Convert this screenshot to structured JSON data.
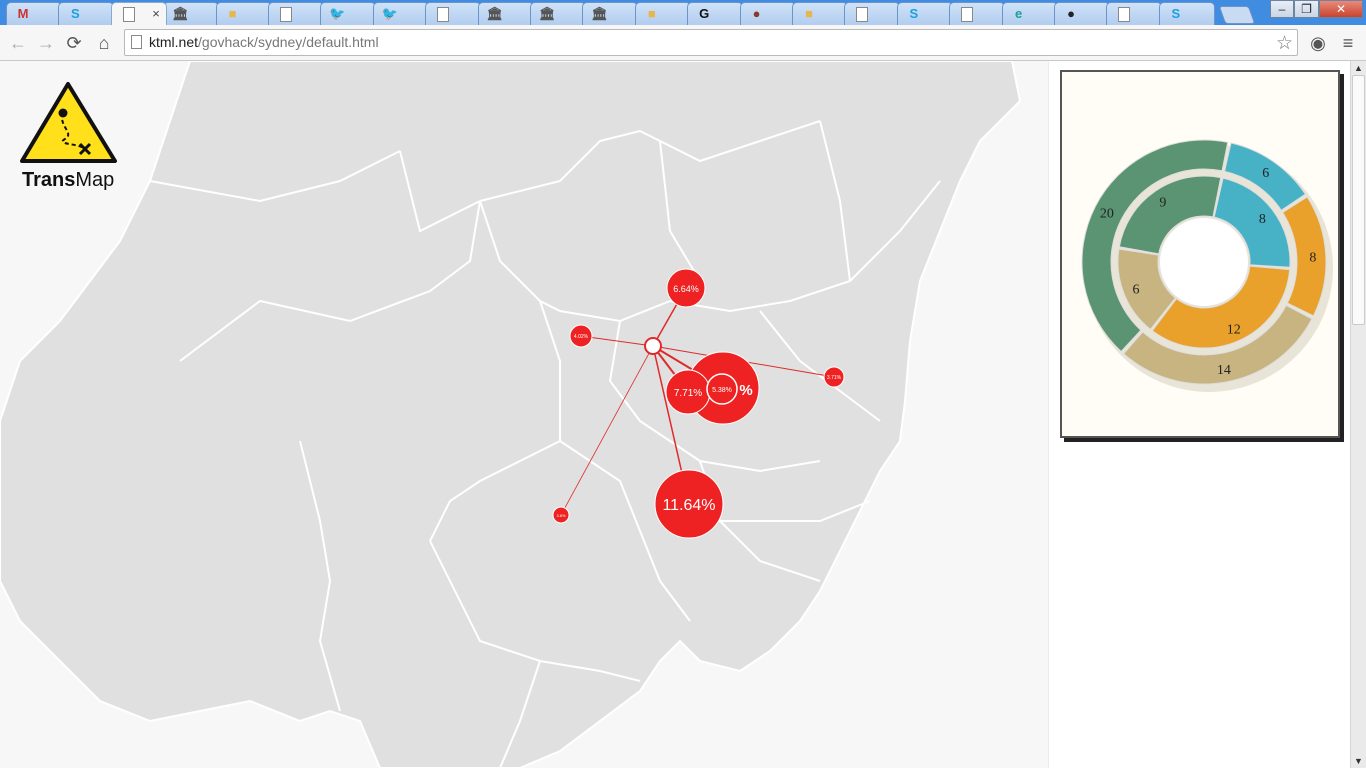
{
  "browser": {
    "tabs": [
      {
        "icon": "gmail-icon",
        "glyph": "M",
        "color": "#c33"
      },
      {
        "icon": "skype-icon",
        "glyph": "S",
        "color": "#1ba0e0"
      },
      {
        "icon": "page-icon",
        "glyph": "",
        "color": "#888",
        "active": true
      },
      {
        "icon": "bank-icon",
        "glyph": "🏛",
        "color": "#555"
      },
      {
        "icon": "box-icon",
        "glyph": "■",
        "color": "#e8b64a"
      },
      {
        "icon": "page-icon",
        "glyph": "",
        "color": "#888"
      },
      {
        "icon": "twitter-icon",
        "glyph": "🐦",
        "color": "#2aa9e0"
      },
      {
        "icon": "twitter-icon",
        "glyph": "🐦",
        "color": "#2aa9e0"
      },
      {
        "icon": "page-icon",
        "glyph": "",
        "color": "#888"
      },
      {
        "icon": "bank-icon",
        "glyph": "🏛",
        "color": "#555"
      },
      {
        "icon": "bank-icon",
        "glyph": "🏛",
        "color": "#555"
      },
      {
        "icon": "bank-icon",
        "glyph": "🏛",
        "color": "#555"
      },
      {
        "icon": "box-icon",
        "glyph": "■",
        "color": "#e8b64a"
      },
      {
        "icon": "g-icon",
        "glyph": "G",
        "color": "#111"
      },
      {
        "icon": "globe-icon",
        "glyph": "●",
        "color": "#8a3a2a"
      },
      {
        "icon": "box-icon",
        "glyph": "■",
        "color": "#e8b64a"
      },
      {
        "icon": "page-icon",
        "glyph": "",
        "color": "#888"
      },
      {
        "icon": "skype-icon",
        "glyph": "S",
        "color": "#1ba0e0"
      },
      {
        "icon": "page-icon",
        "glyph": "",
        "color": "#888"
      },
      {
        "icon": "e-icon",
        "glyph": "e",
        "color": "#1aa09a"
      },
      {
        "icon": "github-icon",
        "glyph": "●",
        "color": "#222"
      },
      {
        "icon": "page-icon",
        "glyph": "",
        "color": "#888"
      },
      {
        "icon": "skype-icon",
        "glyph": "S",
        "color": "#1ba0e0"
      }
    ],
    "active_tab_close": "×",
    "url_host": "ktml.net",
    "url_path": "/govhack/sydney/default.html",
    "window_buttons": {
      "minimize": "–",
      "restore": "❐",
      "close": "✕"
    }
  },
  "logo": {
    "bold": "Trans",
    "rest": "Map"
  },
  "map": {
    "hub": "origin",
    "destinations": [
      {
        "label": "6.64%",
        "size": "medium"
      },
      {
        "label": "4.02%",
        "size": "small"
      },
      {
        "label": "7.71%",
        "size": "medium"
      },
      {
        "label": "5.38%",
        "size": "small"
      },
      {
        "label": "%",
        "size": "large"
      },
      {
        "label": "3.71%",
        "size": "small"
      },
      {
        "label": "11.64%",
        "size": "large"
      },
      {
        "label": "3.8%",
        "size": "small"
      }
    ]
  },
  "colors": {
    "marker": "#ee2222",
    "green": "#5a9472",
    "teal": "#47b1c6",
    "orange": "#eaa12b",
    "tan": "#c8b480",
    "region": "#e0e0e0"
  },
  "chart_data": {
    "type": "donut",
    "rings": [
      {
        "ring": "outer",
        "values": [
          6,
          8,
          14,
          20
        ]
      },
      {
        "ring": "inner",
        "values": [
          8,
          12,
          6,
          9
        ]
      }
    ],
    "segment_colors": [
      "#47b1c6",
      "#eaa12b",
      "#c8b480",
      "#5a9472"
    ]
  }
}
